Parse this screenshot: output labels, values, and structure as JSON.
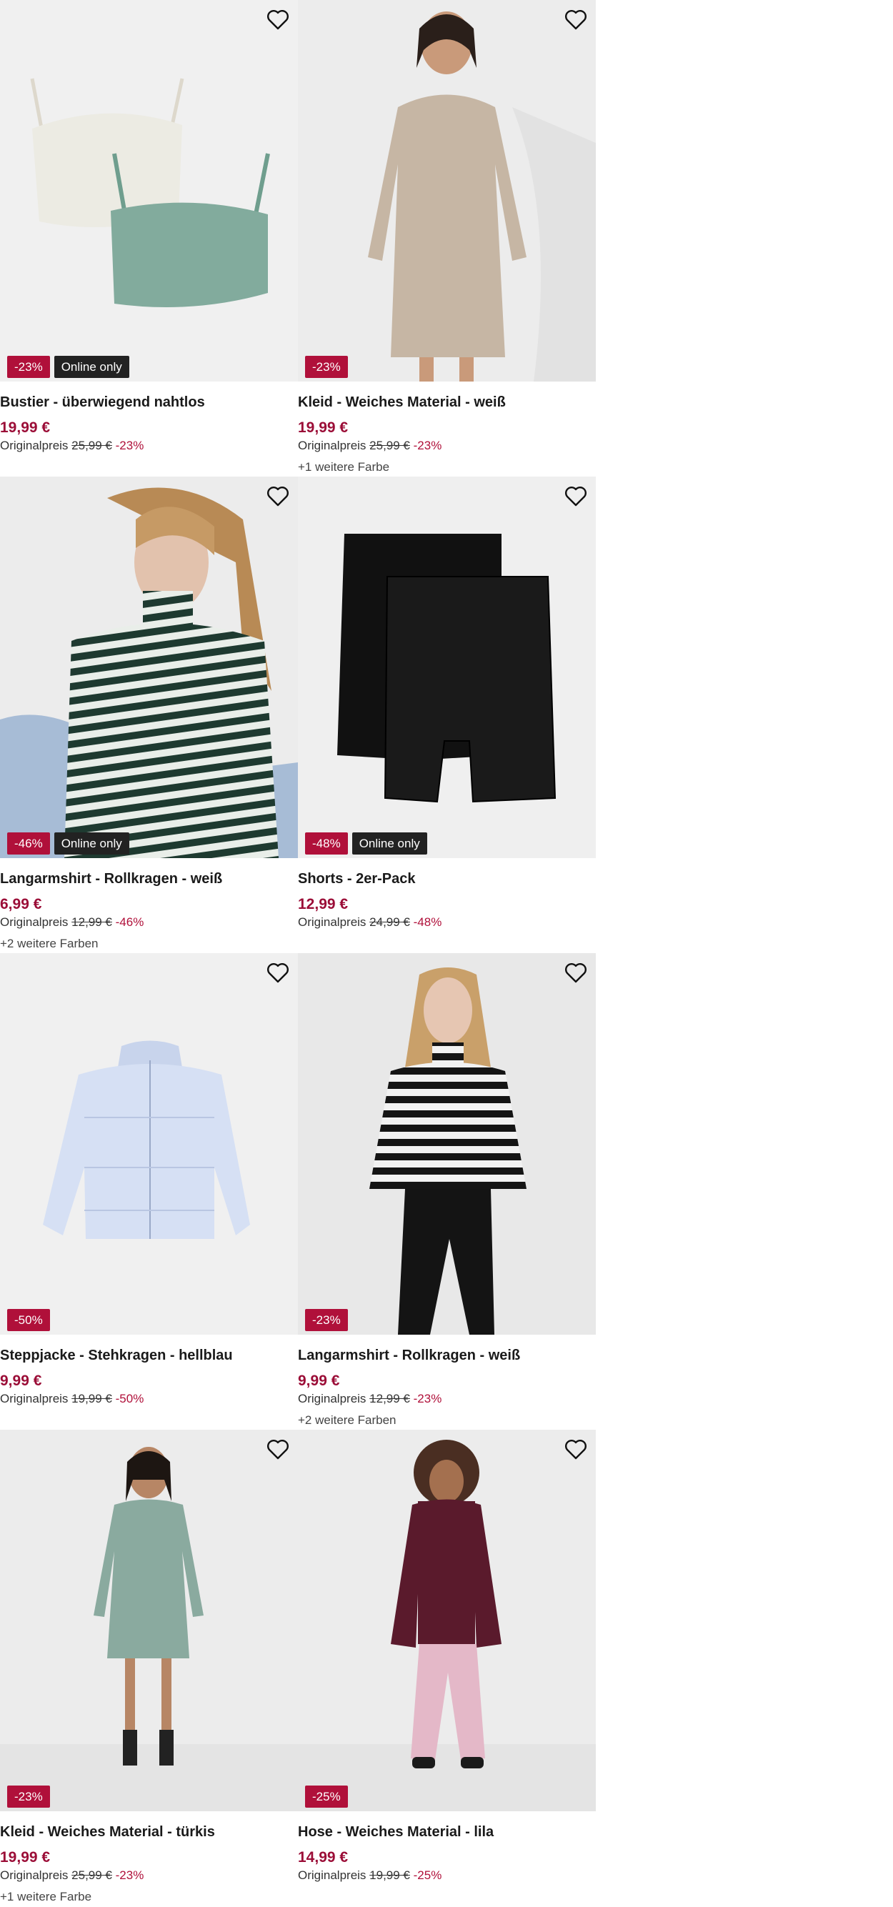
{
  "colors": {
    "sale_badge": "#b0103a",
    "online_badge": "#222222",
    "price": "#9b0d37"
  },
  "products": [
    {
      "title": "Bustier - überwiegend nahtlos",
      "price": "19,99 €",
      "orig_label": "Originalpreis",
      "orig_price": "25,99 €",
      "discount": "-23%",
      "badge_sale": "-23%",
      "badge_online": "Online only",
      "extra_colors": ""
    },
    {
      "title": "Kleid - Weiches Material - weiß",
      "price": "19,99 €",
      "orig_label": "Originalpreis",
      "orig_price": "25,99 €",
      "discount": "-23%",
      "badge_sale": "-23%",
      "badge_online": "",
      "extra_colors": "+1 weitere Farbe"
    },
    {
      "title": "Langarmshirt - Rollkragen - weiß",
      "price": "6,99 €",
      "orig_label": "Originalpreis",
      "orig_price": "12,99 €",
      "discount": "-46%",
      "badge_sale": "-46%",
      "badge_online": "Online only",
      "extra_colors": "+2 weitere Farben"
    },
    {
      "title": "Shorts - 2er-Pack",
      "price": "12,99 €",
      "orig_label": "Originalpreis",
      "orig_price": "24,99 €",
      "discount": "-48%",
      "badge_sale": "-48%",
      "badge_online": "Online only",
      "extra_colors": ""
    },
    {
      "title": "Steppjacke - Stehkragen - hellblau",
      "price": "9,99 €",
      "orig_label": "Originalpreis",
      "orig_price": "19,99 €",
      "discount": "-50%",
      "badge_sale": "-50%",
      "badge_online": "",
      "extra_colors": ""
    },
    {
      "title": "Langarmshirt - Rollkragen - weiß",
      "price": "9,99 €",
      "orig_label": "Originalpreis",
      "orig_price": "12,99 €",
      "discount": "-23%",
      "badge_sale": "-23%",
      "badge_online": "",
      "extra_colors": "+2 weitere Farben"
    },
    {
      "title": "Kleid - Weiches Material - türkis",
      "price": "19,99 €",
      "orig_label": "Originalpreis",
      "orig_price": "25,99 €",
      "discount": "-23%",
      "badge_sale": "-23%",
      "badge_online": "",
      "extra_colors": "+1 weitere Farbe"
    },
    {
      "title": "Hose - Weiches Material - lila",
      "price": "14,99 €",
      "orig_label": "Originalpreis",
      "orig_price": "19,99 €",
      "discount": "-25%",
      "badge_sale": "-25%",
      "badge_online": "",
      "extra_colors": ""
    }
  ]
}
